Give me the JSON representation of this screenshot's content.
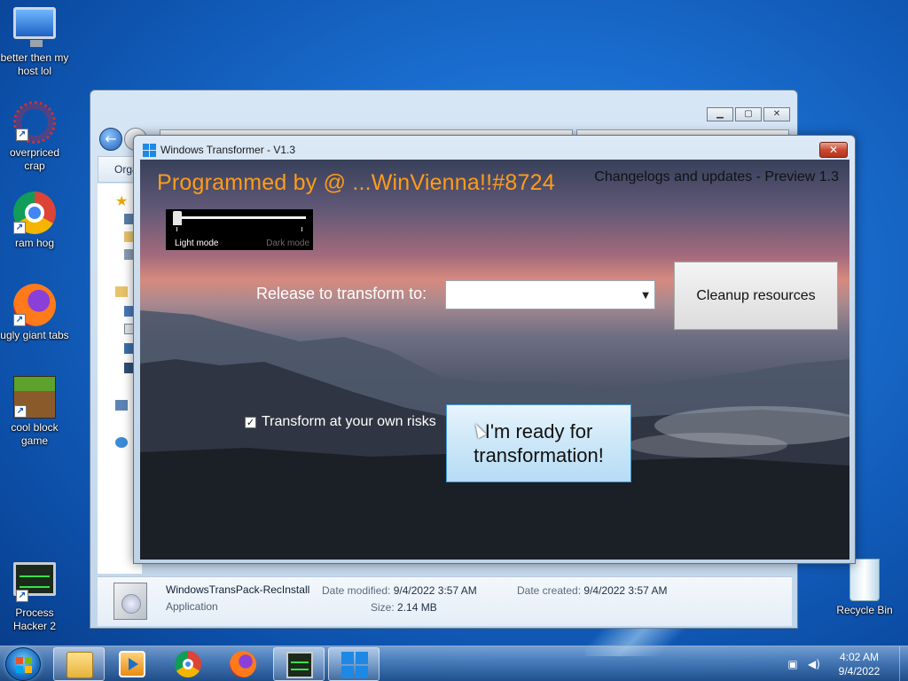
{
  "desktop": {
    "icons": [
      {
        "label": "better then my host lol",
        "icon": "computer-icon"
      },
      {
        "label": "overpriced crap",
        "icon": "overpriced-crap-icon"
      },
      {
        "label": "ram hog",
        "icon": "chrome-icon"
      },
      {
        "label": "ugly giant tabs",
        "icon": "firefox-icon"
      },
      {
        "label": "cool block game",
        "icon": "minecraft-icon"
      },
      {
        "label": "Process Hacker 2",
        "icon": "process-hacker-icon"
      },
      {
        "label": "Recycle Bin",
        "icon": "recycle-bin-icon"
      }
    ]
  },
  "explorer": {
    "cmdbar_label": "Orga",
    "details": {
      "file_name": "WindowsTransPack-RecInstall",
      "file_type": "Application",
      "date_modified_label": "Date modified:",
      "date_modified": "9/4/2022 3:57 AM",
      "date_created_label": "Date created:",
      "date_created": "9/4/2022 3:57 AM",
      "size_label": "Size:",
      "size": "2.14 MB"
    }
  },
  "transformer": {
    "window_title": "Windows Transformer - V1.3",
    "close_glyph": "✕",
    "heading": "Programmed by @ ...WinVienna!!#8724",
    "changelog_link": "Changelogs and updates - Preview 1.3",
    "theme_slider": {
      "left_label": "Light mode",
      "right_label": "Dark mode",
      "value": 0
    },
    "release_label": "Release to transform to:",
    "release_value": "",
    "cleanup_button": "Cleanup resources",
    "risk_checkbox": {
      "label": "Transform at your own risks",
      "checked": true,
      "glyph": "✓"
    },
    "ready_button_line1": "I'm ready for",
    "ready_button_line2": "transformation!"
  },
  "taskbar": {
    "items": [
      "explorer-icon",
      "media-player-icon",
      "chrome-icon",
      "firefox-icon",
      "process-hacker-icon",
      "windows-transformer-icon"
    ],
    "clock_time": "4:02 AM",
    "clock_date": "9/4/2022"
  },
  "colors": {
    "heading_orange": "#ff9c1a",
    "desktop_blue": "#1a6ed0",
    "ready_button_blue": "#cce7f8"
  }
}
